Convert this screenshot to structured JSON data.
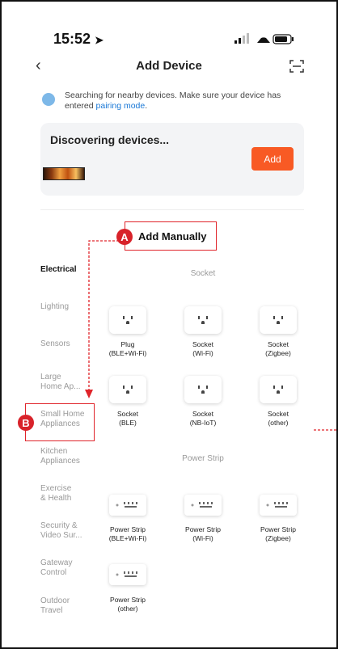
{
  "status": {
    "time": "15:52"
  },
  "header": {
    "title": "Add Device"
  },
  "hint": {
    "text": "Searching for nearby devices. Make sure your device has entered ",
    "link": "pairing mode",
    "end": "."
  },
  "discover": {
    "title": "Discovering devices...",
    "add_label": "Add"
  },
  "annotations": {
    "a_badge": "A",
    "a_label": "Add Manually",
    "b_badge": "B"
  },
  "categories": [
    {
      "line1": "Electrical",
      "line2": ""
    },
    {
      "line1": "Lighting",
      "line2": ""
    },
    {
      "line1": "Sensors",
      "line2": ""
    },
    {
      "line1": "Large",
      "line2": "Home Ap..."
    },
    {
      "line1": "Small Home",
      "line2": "Appliances"
    },
    {
      "line1": "Kitchen",
      "line2": "Appliances"
    },
    {
      "line1": "Exercise",
      "line2": "& Health"
    },
    {
      "line1": "Security &",
      "line2": "Video Sur..."
    },
    {
      "line1": "Gateway",
      "line2": "Control"
    },
    {
      "line1": "Outdoor",
      "line2": "Travel"
    }
  ],
  "sections": {
    "socket": "Socket",
    "power_strip": "Power Strip"
  },
  "sockets": [
    {
      "name": "Plug",
      "sub": "(BLE+Wi-Fi)"
    },
    {
      "name": "Socket",
      "sub": "(Wi-Fi)"
    },
    {
      "name": "Socket",
      "sub": "(Zigbee)"
    },
    {
      "name": "Socket",
      "sub": "(BLE)"
    },
    {
      "name": "Socket",
      "sub": "(NB-IoT)"
    },
    {
      "name": "Socket",
      "sub": "(other)"
    }
  ],
  "strips": [
    {
      "name": "Power Strip",
      "sub": "(BLE+Wi-Fi)"
    },
    {
      "name": "Power Strip",
      "sub": "(Wi-Fi)"
    },
    {
      "name": "Power Strip",
      "sub": "(Zigbee)"
    },
    {
      "name": "Power Strip",
      "sub": "(other)"
    }
  ]
}
